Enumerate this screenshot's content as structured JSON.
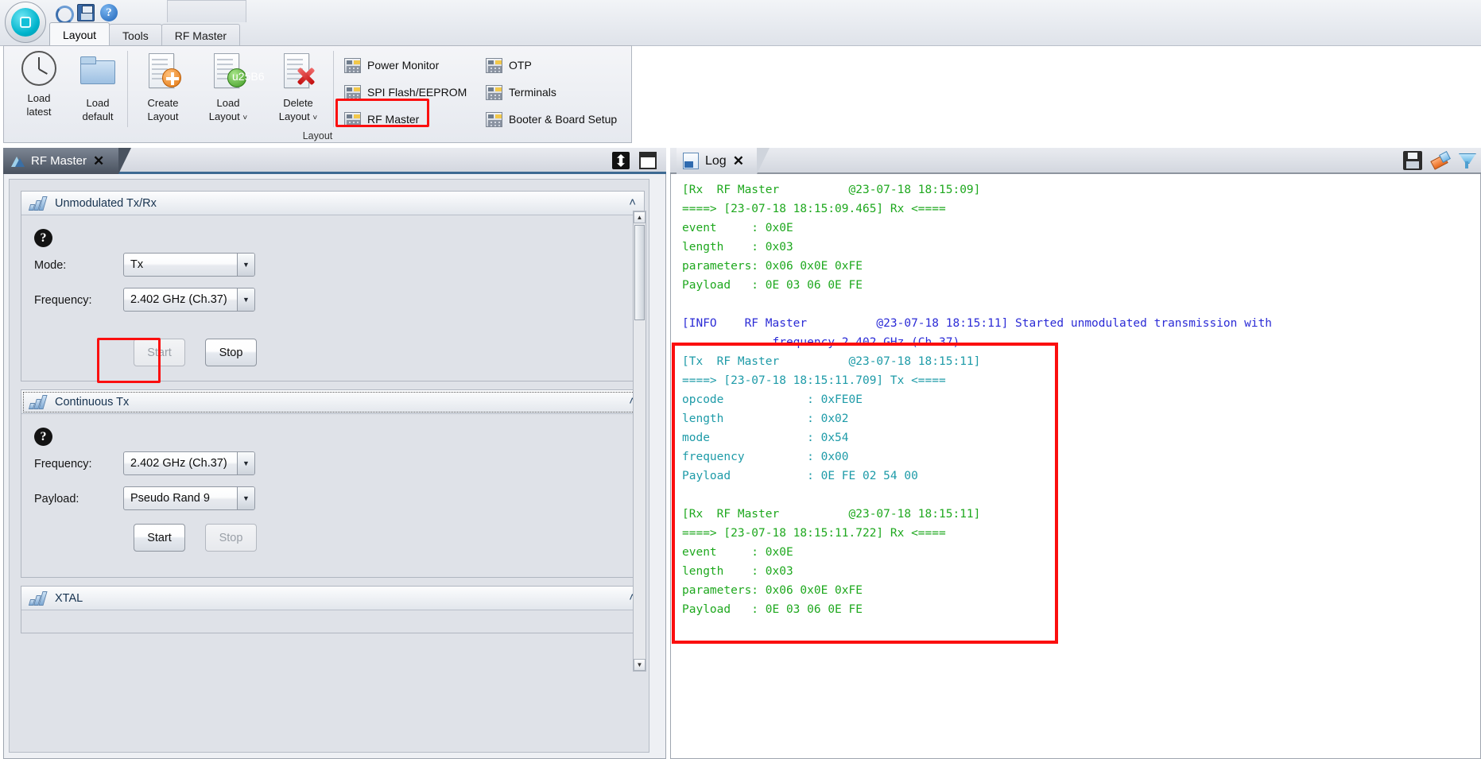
{
  "app": {
    "orb_name": "application-orb",
    "quick_access": [
      {
        "name": "refresh-icon",
        "title": "Refresh"
      },
      {
        "name": "save-icon",
        "title": "Save"
      },
      {
        "name": "help-icon",
        "title": "Help",
        "glyph": "?"
      }
    ]
  },
  "ribbon": {
    "tabs": [
      {
        "label": "Layout",
        "active": true
      },
      {
        "label": "Tools",
        "active": false
      },
      {
        "label": "RF Master",
        "active": false
      }
    ],
    "group_caption": "Layout",
    "big_buttons": [
      {
        "label_line1": "Load",
        "label_line2": "latest",
        "icon": "clock-icon"
      },
      {
        "label_line1": "Load",
        "label_line2": "default",
        "icon": "folder-icon"
      },
      {
        "label_line1": "Create",
        "label_line2": "Layout",
        "icon": "page-plus-icon"
      },
      {
        "label_line1": "Load",
        "label_line2": "Layout",
        "caret": "˅",
        "icon": "page-arrow-icon"
      },
      {
        "label_line1": "Delete",
        "label_line2": "Layout",
        "caret": "˅",
        "icon": "page-delete-icon"
      }
    ],
    "small_items": [
      {
        "label": "Power Monitor",
        "icon": "window-icon",
        "highlighted": false
      },
      {
        "label": "SPI Flash/EEPROM",
        "icon": "window-icon",
        "highlighted": false
      },
      {
        "label": "RF Master",
        "icon": "window-icon",
        "highlighted": true
      },
      {
        "label": "OTP",
        "icon": "window-icon",
        "highlighted": false
      },
      {
        "label": "Terminals",
        "icon": "window-icon",
        "highlighted": false
      },
      {
        "label": "Booter & Board Setup",
        "icon": "window-icon",
        "highlighted": false
      }
    ]
  },
  "rf_master_panel": {
    "tab_label": "RF Master",
    "close_glyph": "✕",
    "controls": {
      "pin": "pin-icon",
      "maximize": "maximize-icon"
    },
    "groups": [
      {
        "title": "Unmodulated Tx/Rx",
        "help_glyph": "?",
        "collapse_glyph": "˄",
        "fields": [
          {
            "label": "Mode:",
            "value": "Tx",
            "arrow": "▼"
          },
          {
            "label": "Frequency:",
            "value": "2.402 GHz (Ch.37)",
            "arrow": "▼"
          }
        ],
        "buttons": [
          {
            "label": "Start",
            "disabled": true,
            "highlighted": true
          },
          {
            "label": "Stop",
            "disabled": false,
            "highlighted": false
          }
        ]
      },
      {
        "title": "Continuous Tx",
        "help_glyph": "?",
        "collapse_glyph": "˄",
        "fields": [
          {
            "label": "Frequency:",
            "value": "2.402 GHz (Ch.37)",
            "arrow": "▼"
          },
          {
            "label": "Payload:",
            "value": "Pseudo Rand 9",
            "arrow": "▼"
          }
        ],
        "buttons": [
          {
            "label": "Start",
            "disabled": false,
            "highlighted": false
          },
          {
            "label": "Stop",
            "disabled": true,
            "highlighted": false
          }
        ]
      },
      {
        "title": "XTAL",
        "collapse_glyph": "˄"
      }
    ],
    "scrollbar": {
      "up_glyph": "▲",
      "down_glyph": "▼"
    }
  },
  "log_panel": {
    "tab_label": "Log",
    "close_glyph": "✕",
    "tools": [
      {
        "name": "save-log-icon"
      },
      {
        "name": "clear-log-icon"
      },
      {
        "name": "filter-log-icon"
      }
    ],
    "entries": [
      {
        "color": "rx",
        "text": "[Rx  RF Master          @23-07-18 18:15:09]"
      },
      {
        "color": "rx",
        "text": "====> [23-07-18 18:15:09.465] Rx <===="
      },
      {
        "color": "rx",
        "text": "event     : 0x0E"
      },
      {
        "color": "rx",
        "text": "length    : 0x03"
      },
      {
        "color": "rx",
        "text": "parameters: 0x06 0x0E 0xFE"
      },
      {
        "color": "rx",
        "text": "Payload   : 0E 03 06 0E FE"
      },
      {
        "color": "rx",
        "text": ""
      },
      {
        "color": "info",
        "text": "[INFO    RF Master          @23-07-18 18:15:11] Started unmodulated transmission with"
      },
      {
        "color": "info",
        "text": "             frequency 2.402 GHz (Ch.37)."
      },
      {
        "color": "tx",
        "text": "[Tx  RF Master          @23-07-18 18:15:11]"
      },
      {
        "color": "tx",
        "text": "====> [23-07-18 18:15:11.709] Tx <===="
      },
      {
        "color": "tx",
        "text": "opcode            : 0xFE0E"
      },
      {
        "color": "tx",
        "text": "length            : 0x02"
      },
      {
        "color": "tx",
        "text": "mode              : 0x54"
      },
      {
        "color": "tx",
        "text": "frequency         : 0x00"
      },
      {
        "color": "tx",
        "text": "Payload           : 0E FE 02 54 00"
      },
      {
        "color": "tx",
        "text": ""
      },
      {
        "color": "rx",
        "text": "[Rx  RF Master          @23-07-18 18:15:11]"
      },
      {
        "color": "rx",
        "text": "====> [23-07-18 18:15:11.722] Rx <===="
      },
      {
        "color": "rx",
        "text": "event     : 0x0E"
      },
      {
        "color": "rx",
        "text": "length    : 0x03"
      },
      {
        "color": "rx",
        "text": "parameters: 0x06 0x0E 0xFE"
      },
      {
        "color": "rx",
        "text": "Payload   : 0E 03 06 0E FE"
      }
    ]
  },
  "colors": {
    "highlight": "#fb0f0f",
    "rx": "#1ea81e",
    "info": "#2b2bd6",
    "tx": "#1e9ba8"
  }
}
